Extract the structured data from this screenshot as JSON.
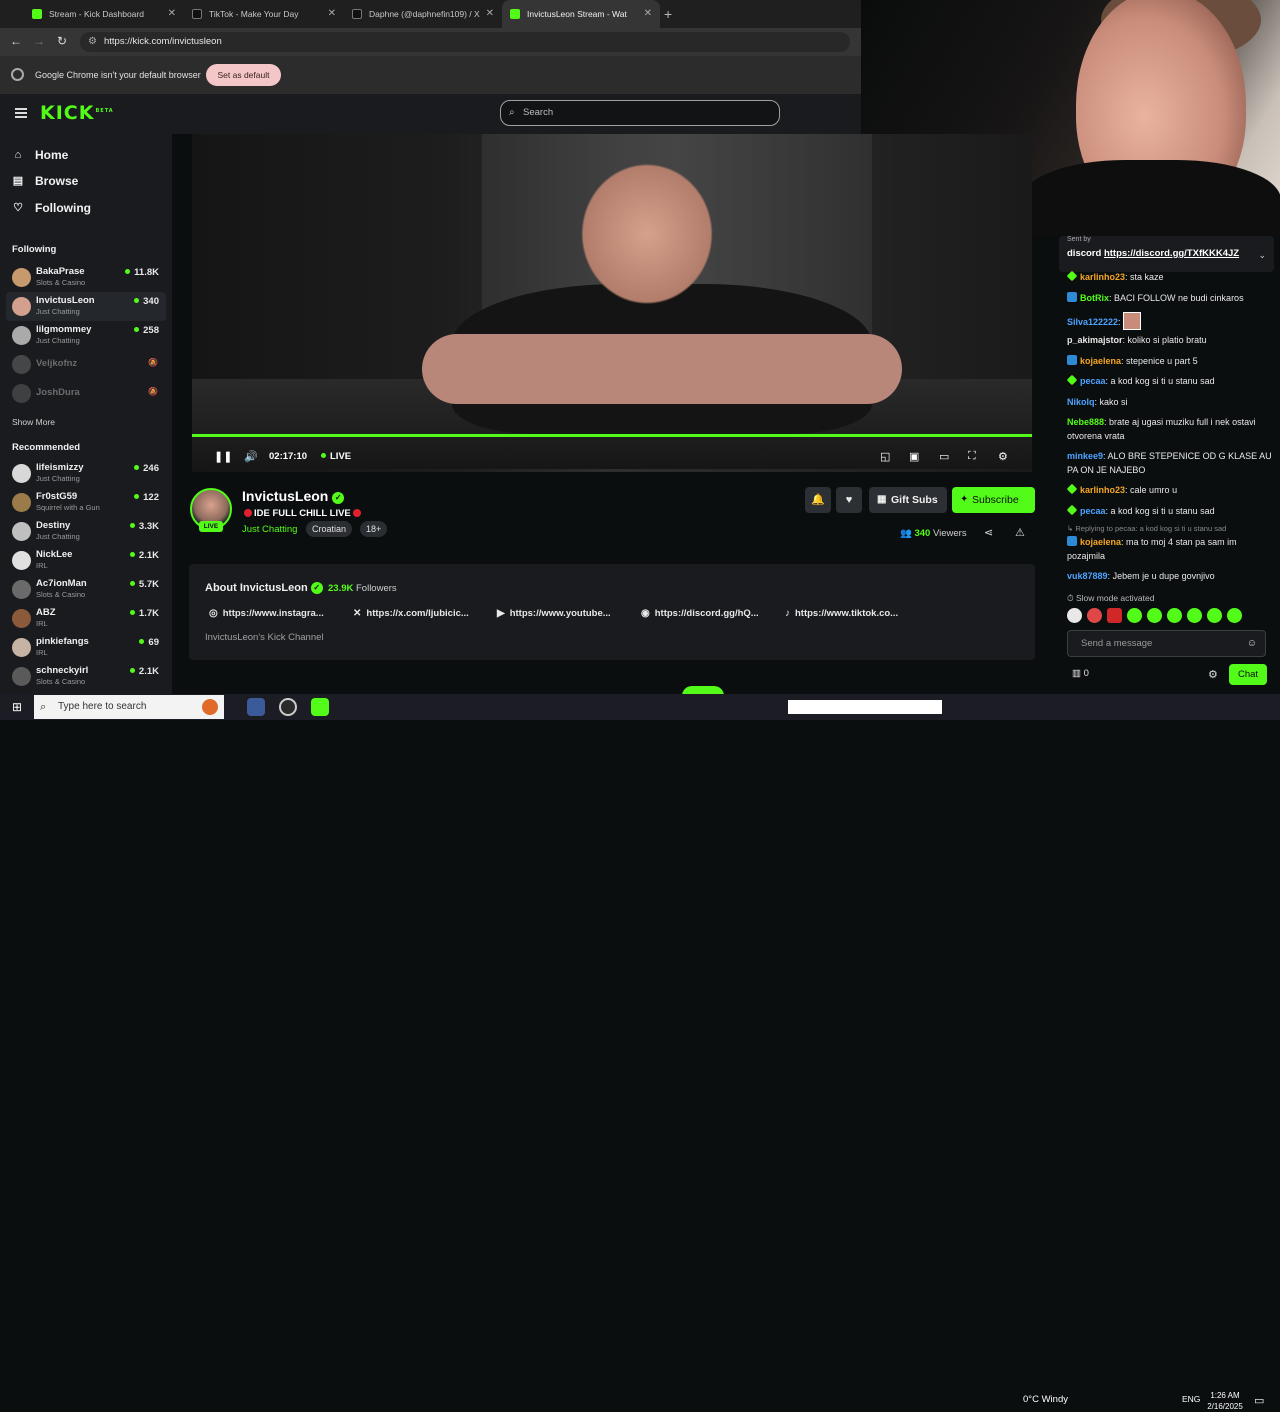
{
  "browser": {
    "tabs": [
      {
        "title": "Stream - Kick Dashboard",
        "color": "#53fc18"
      },
      {
        "title": "TikTok - Make Your Day",
        "color": "#111111"
      },
      {
        "title": "Daphne (@daphnefin109) / X",
        "color": "#111111"
      },
      {
        "title": "InvictusLeon Stream - Wat",
        "color": "#53fc18"
      }
    ],
    "url": "https://kick.com/invictusleon",
    "infobar_message": "Google Chrome isn't your default browser",
    "infobar_button": "Set as default"
  },
  "header": {
    "logo": "KICK",
    "logo_sup": "BETA",
    "search_placeholder": "Search"
  },
  "sidebar": {
    "nav": [
      {
        "label": "Home",
        "icon": "home-icon"
      },
      {
        "label": "Browse",
        "icon": "browse-icon"
      },
      {
        "label": "Following",
        "icon": "heart-icon"
      }
    ],
    "following_title": "Following",
    "following": [
      {
        "name": "BakaPrase",
        "category": "Slots & Casino",
        "viewers": "11.8K",
        "color": "#c79a6e"
      },
      {
        "name": "InvictusLeon",
        "category": "Just Chatting",
        "viewers": "340",
        "color": "#d2a08c"
      },
      {
        "name": "lilgmommey",
        "category": "Just Chatting",
        "viewers": "258",
        "color": "#aaaaaa"
      },
      {
        "name": "Veljkofnz",
        "color": "#888888"
      },
      {
        "name": "JoshDura",
        "color": "#777777"
      }
    ],
    "show_more": "Show More",
    "recommended_title": "Recommended",
    "recommended": [
      {
        "name": "lifeismizzy",
        "category": "Just Chatting",
        "viewers": "246",
        "color": "#d8d8d8"
      },
      {
        "name": "Fr0stG59",
        "category": "Squirrel with a Gun",
        "viewers": "122",
        "color": "#9c7b4a"
      },
      {
        "name": "Destiny",
        "category": "Just Chatting",
        "viewers": "3.3K",
        "color": "#bfbfbf"
      },
      {
        "name": "NickLee",
        "category": "IRL",
        "viewers": "2.1K",
        "color": "#e0e0e0"
      },
      {
        "name": "Ac7ionMan",
        "category": "Slots & Casino",
        "viewers": "5.7K",
        "color": "#6a6a6a"
      },
      {
        "name": "ABZ",
        "category": "IRL",
        "viewers": "1.7K",
        "color": "#8a5a3a"
      },
      {
        "name": "pinkiefangs",
        "category": "IRL",
        "viewers": "69",
        "color": "#c7b3a3"
      },
      {
        "name": "schneckyirl",
        "category": "Slots & Casino",
        "viewers": "2.1K",
        "color": "#5a5a5a"
      }
    ]
  },
  "player": {
    "time": "02:17:10",
    "live": "LIVE"
  },
  "channel": {
    "name": "InvictusLeon",
    "live_badge": "LIVE",
    "title": "IDE FULL CHILL LIVE",
    "category": "Just Chatting",
    "tags": [
      "Croatian",
      "18+"
    ],
    "gift_subs": "Gift Subs",
    "subscribe": "Subscribe",
    "viewer_count": "340",
    "viewers_label": "Viewers"
  },
  "about": {
    "title": "About InvictusLeon",
    "followers_count": "23.9K",
    "followers_label": "Followers",
    "links": [
      {
        "icon": "instagram-icon",
        "text": "https://www.instagra..."
      },
      {
        "icon": "x-icon",
        "text": "https://x.com/ljubicic..."
      },
      {
        "icon": "youtube-icon",
        "text": "https://www.youtube..."
      },
      {
        "icon": "discord-icon",
        "text": "https://discord.gg/hQ..."
      },
      {
        "icon": "tiktok-icon",
        "text": "https://www.tiktok.co..."
      }
    ],
    "description": "InvictusLeon's Kick Channel"
  },
  "chat": {
    "pinned_sent_by": "Sent by",
    "pinned_prefix": "discord",
    "pinned_link": "https://discord.gg/TXfKKK4JZ",
    "messages": [
      {
        "user": "karlinho23",
        "color": "#f5a623",
        "badge": "g",
        "text": "sta kaze"
      },
      {
        "user": "BotRix",
        "color": "#53fc18",
        "badge": "b",
        "text": "BACI FOLLOW ne budi cinkaros"
      },
      {
        "user": "Silva122222",
        "color": "#4da3ff",
        "badge": "",
        "text": ""
      },
      {
        "user": "p_akimajstor",
        "color": "#e8e8e8",
        "badge": "",
        "text": "koliko si platio bratu"
      },
      {
        "user": "kojaelena",
        "color": "#f5a623",
        "badge": "b",
        "text": "stepenice u part 5"
      },
      {
        "user": "pecaa",
        "color": "#4da3ff",
        "badge": "g",
        "text": "a kod kog si ti u stanu sad"
      },
      {
        "user": "Nikolq",
        "color": "#4da3ff",
        "badge": "",
        "text": "kako si"
      },
      {
        "user": "Nebe888",
        "color": "#53fc18",
        "badge": "",
        "text": "brate aj ugasi muziku full i nek ostavi otvorena vrata"
      },
      {
        "user": "minkee9",
        "color": "#4da3ff",
        "badge": "",
        "text": "ALO BRE STEPENICE OD G KLASE AU PA ON JE NAJEBO"
      },
      {
        "user": "karlinho23",
        "color": "#f5a623",
        "badge": "g",
        "text": "cale umro u"
      },
      {
        "user": "pecaa",
        "color": "#4da3ff",
        "badge": "g",
        "text": "a kod kog si ti u stanu sad"
      },
      {
        "user": "kojaelena",
        "color": "#f5a623",
        "badge": "b",
        "text": "ma to moj 4 stan pa sam im pozajmila"
      },
      {
        "user": "vuk87889",
        "color": "#4da3ff",
        "badge": "",
        "text": "Jebem je u dupe govnjivo"
      }
    ],
    "reply_note": "Replying to pecaa: a kod kog si ti u stanu sad",
    "slow_mode": "Slow mode activated",
    "send_placeholder": "Send a message",
    "points": "0",
    "chat_button": "Chat"
  },
  "taskbar": {
    "search_placeholder": "Type here to search",
    "weather": "0°C  Windy",
    "language": "ENG",
    "time": "1:26 AM",
    "date": "2/16/2025"
  }
}
